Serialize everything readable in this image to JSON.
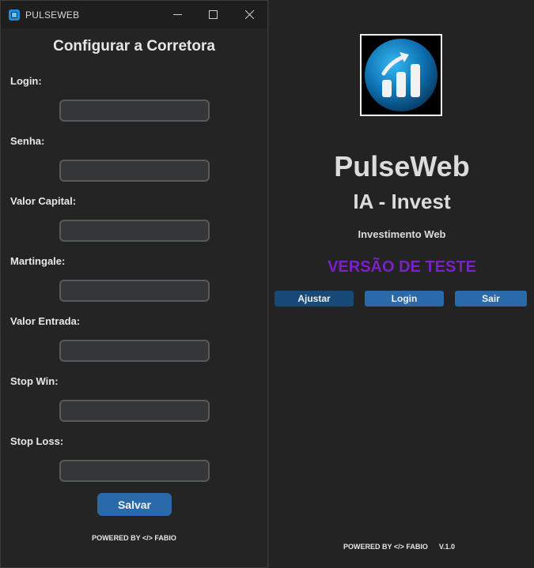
{
  "main_window": {
    "app_name": "PulseWeb",
    "subtitle": "IA - Invest",
    "tagline": "Investimento Web",
    "test_banner": "VERSÃO DE TESTE",
    "test_banner_color": "#7d1fc7",
    "logo_icon": "growth-chart-logo",
    "buttons": {
      "ajustar": "Ajustar",
      "login": "Login",
      "sair": "Sair"
    },
    "footer": "POWERED BY </> FABIO",
    "version": "V.1.0"
  },
  "config_dialog": {
    "window_title": "PULSEWEB",
    "title": "Configurar a Corretora",
    "fields": {
      "login": {
        "label": "Login:",
        "value": ""
      },
      "senha": {
        "label": "Senha:",
        "value": ""
      },
      "valor_capital": {
        "label": "Valor Capital:",
        "value": ""
      },
      "martingale": {
        "label": "Martingale:",
        "value": ""
      },
      "valor_entrada": {
        "label": "Valor Entrada:",
        "value": ""
      },
      "stop_win": {
        "label": "Stop Win:",
        "value": ""
      },
      "stop_loss": {
        "label": "Stop Loss:",
        "value": ""
      }
    },
    "save_label": "Salvar",
    "footer": "POWERED BY </> FABIO"
  },
  "colors": {
    "accent_button": "#2a6aaa",
    "dark_button": "#184a78",
    "background": "#242424"
  }
}
